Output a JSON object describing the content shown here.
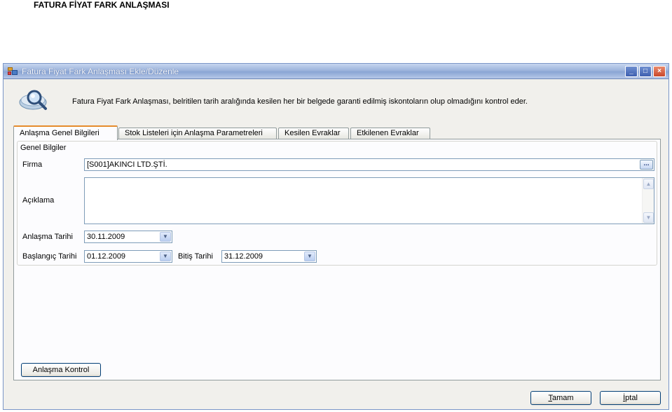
{
  "document": {
    "heading": "FATURA FİYAT FARK ANLAŞMASI"
  },
  "window": {
    "title": "Fatura Fiyat Fark Anlaşması Ekle/Düzenle",
    "controls": {
      "minimize": "_",
      "maximize": "□",
      "close": "×"
    }
  },
  "header": {
    "icon": "search-magnifier-icon",
    "description": "Fatura Fiyat Fark Anlaşması, belritilen tarih aralığında kesilen her bir belgede garanti edilmiş iskontoların olup olmadığını kontrol eder."
  },
  "tabs": [
    {
      "label": "Anlaşma Genel Bilgileri",
      "active": true
    },
    {
      "label": "Stok Listeleri için Anlaşma Parametreleri",
      "active": false
    },
    {
      "label": "Kesilen Evraklar",
      "active": false
    },
    {
      "label": "Etkilenen Evraklar",
      "active": false
    }
  ],
  "form": {
    "group_title": "Genel Bilgiler",
    "firma_label": "Firma",
    "firma_value": "[S001]AKINCI LTD.ŞTİ.",
    "firma_button": "...",
    "aciklama_label": "Açıklama",
    "aciklama_value": "",
    "anlasma_tarihi_label": "Anlaşma Tarihi",
    "anlasma_tarihi_value": "30.11.2009",
    "baslangic_tarihi_label": "Başlangıç Tarihi",
    "baslangic_tarihi_value": "01.12.2009",
    "bitis_tarihi_label": "Bitiş Tarihi",
    "bitis_tarihi_value": "31.12.2009"
  },
  "buttons": {
    "anlasma_kontrol": "Anlaşma Kontrol",
    "tamam_first": "T",
    "tamam_rest": "amam",
    "iptal_first": "İ",
    "iptal_rest": "ptal"
  },
  "icons": {
    "scroll_up": "▲",
    "scroll_down": "▼",
    "dropdown": "▼"
  },
  "colors": {
    "titlebar": "#9db4dc",
    "active_tab_accent": "#e68b2c",
    "field_border": "#7f9db9",
    "window_bg": "#f1f0ec"
  }
}
